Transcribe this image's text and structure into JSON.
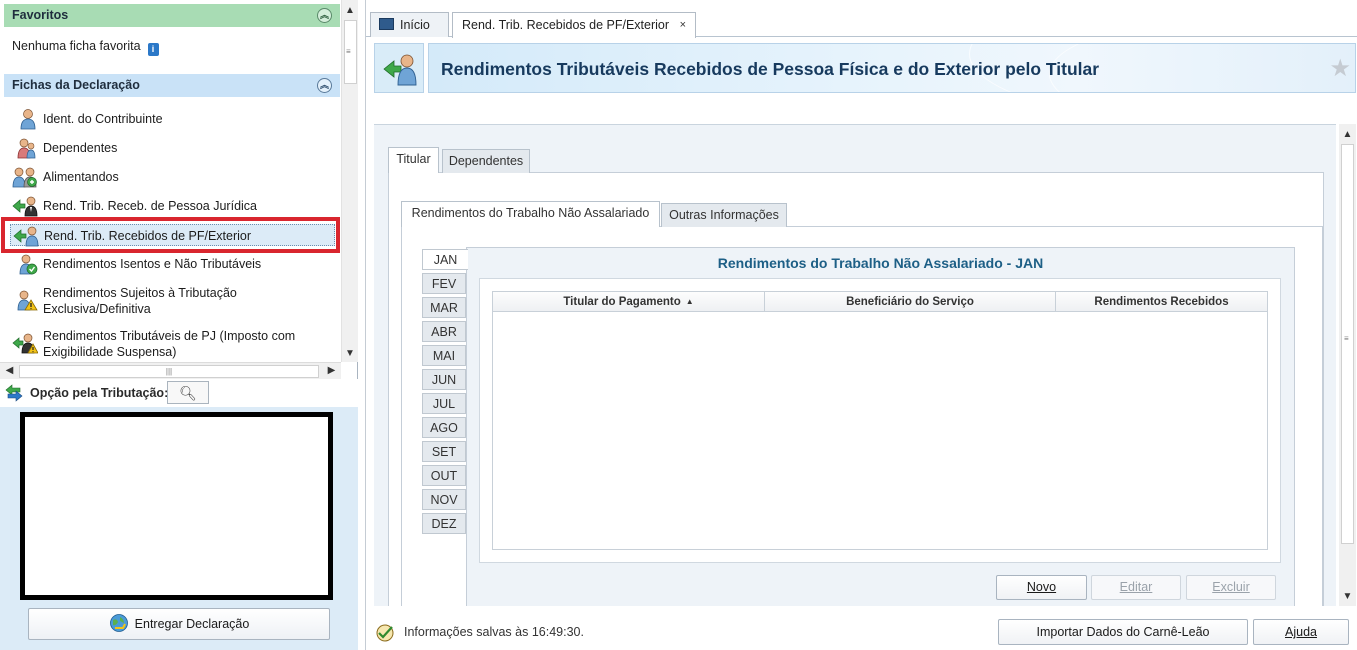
{
  "left": {
    "favoritos": {
      "title": "Favoritos",
      "empty_text": "Nenhuma ficha favorita"
    },
    "fichas": {
      "title": "Fichas da Declaração",
      "items": [
        {
          "label": "Ident. do Contribuinte",
          "icon": "person-icon"
        },
        {
          "label": "Dependentes",
          "icon": "dependents-icon"
        },
        {
          "label": "Alimentandos",
          "icon": "alimentandos-icon"
        },
        {
          "label": "Rend. Trib. Receb. de Pessoa Jurídica",
          "icon": "income-pj-icon"
        },
        {
          "label": "Rend. Trib. Recebidos de PF/Exterior",
          "icon": "income-pf-icon",
          "selected": true
        },
        {
          "label": "Rendimentos Isentos e Não Tributáveis",
          "icon": "exempt-income-icon"
        },
        {
          "label": "Rendimentos Sujeitos à Tributação Exclusiva/Definitiva",
          "icon": "warning-income-icon"
        },
        {
          "label": "Rendimentos Tributáveis de PJ (Imposto com Exigibilidade Suspensa)",
          "icon": "suspended-income-icon"
        }
      ]
    },
    "opcao_label": "Opção pela Tributação:",
    "entregar_label": "Entregar Declaração"
  },
  "tabs": {
    "inicio": "Início",
    "current": "Rend. Trib. Recebidos de PF/Exterior",
    "close": "×"
  },
  "header": {
    "title": "Rendimentos Tributáveis Recebidos de Pessoa Física e do Exterior pelo Titular",
    "star": "★"
  },
  "subtabs": {
    "titular": "Titular",
    "dependentes": "Dependentes",
    "trabalho": "Rendimentos do Trabalho Não Assalariado",
    "outras": "Outras Informações"
  },
  "months": [
    "JAN",
    "FEV",
    "MAR",
    "ABR",
    "MAI",
    "JUN",
    "JUL",
    "AGO",
    "SET",
    "OUT",
    "NOV",
    "DEZ"
  ],
  "active_month": "JAN",
  "panel_title": "Rendimentos do Trabalho Não Assalariado - JAN",
  "grid": {
    "columns": [
      "Titular do Pagamento",
      "Beneficiário do Serviço",
      "Rendimentos Recebidos"
    ],
    "sort_indicator": "▲",
    "rows": []
  },
  "buttons": {
    "novo": "Novo",
    "editar": "Editar",
    "excluir": "Excluir",
    "importar": "Importar Dados do Carnê-Leão",
    "ajuda": "Ajuda"
  },
  "status": "Informações salvas às 16:49:30.",
  "colors": {
    "selected_highlight": "#d9262e",
    "title_blue": "#173a5e",
    "panel_title": "#1d5f86",
    "favoritos_bg": "#a8dcb4",
    "fichas_bg": "#c9e2f7"
  }
}
